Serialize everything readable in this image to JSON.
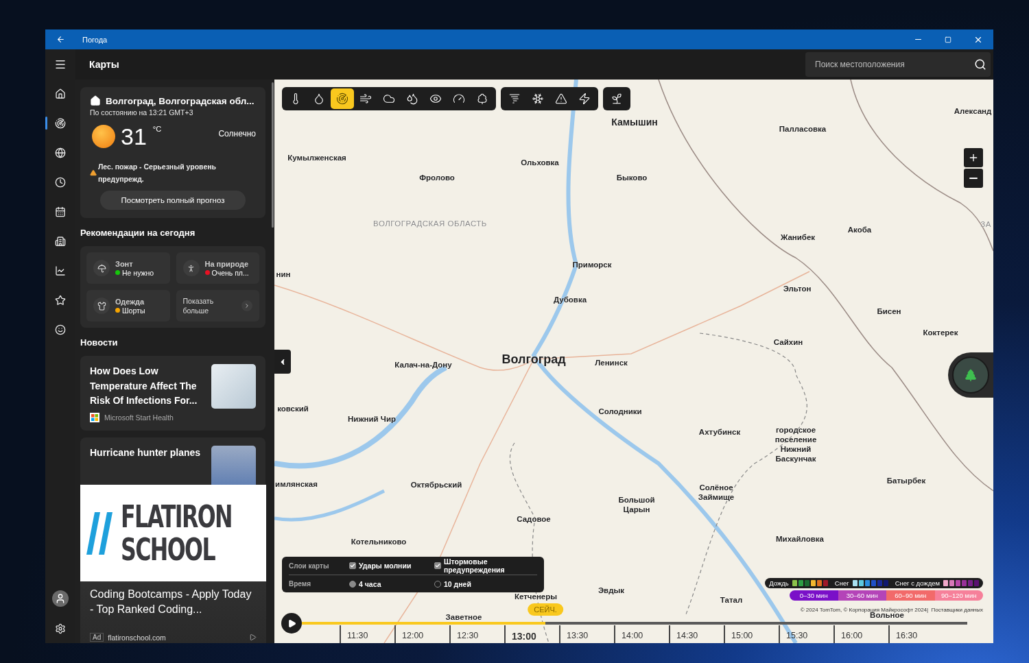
{
  "window": {
    "title": "Погода"
  },
  "nav": {
    "items": [
      {
        "selected": false
      },
      {
        "selected": true
      },
      {
        "selected": false
      },
      {
        "selected": false
      },
      {
        "selected": false
      },
      {
        "selected": false
      },
      {
        "selected": false
      },
      {
        "selected": false
      },
      {
        "selected": false
      }
    ]
  },
  "header": {
    "title": "Карты",
    "search": {
      "placeholder": "Поиск местоположения"
    }
  },
  "weather": {
    "location": "Волгоград, Волгоградская обл...",
    "updated": "По состоянию на 13:21 GMT+3",
    "temperature": "31",
    "unit": "°C",
    "condition": "Солнечно",
    "alert": "Лес. пожар - Серьезный уровень предупрежд.",
    "button": "Посмотреть полный прогноз"
  },
  "recommendations": {
    "title": "Рекомендации на сегодня",
    "tiles": [
      {
        "kind": "status",
        "title": "Зонт",
        "value": "Не нужно",
        "color": "#16c60c"
      },
      {
        "kind": "status",
        "title": "На природе",
        "value": "Очень пл...",
        "color": "#e81123"
      },
      {
        "kind": "status",
        "title": "Одежда",
        "value": "Шорты",
        "color": "#f7a500"
      },
      {
        "kind": "more",
        "title": "Показать больше"
      }
    ]
  },
  "news": {
    "title": "Новости",
    "items": [
      {
        "title": "How Does Low Temperature Affect The Risk Of Infections For...",
        "source": "Microsoft Start Health"
      },
      {
        "title": "Hurricane hunter planes"
      }
    ]
  },
  "ad": {
    "logo": [
      "FLATIRON",
      "SCHOOL"
    ],
    "title": "Coding Bootcamps - Apply Today - Top Ranked Coding...",
    "badge": "Ad",
    "domain": "flatironschool.com"
  },
  "toolbar": {
    "groups": [
      [
        {
          "selected": false
        },
        {
          "selected": false
        },
        {
          "selected": true
        },
        {
          "selected": false
        },
        {
          "selected": false
        },
        {
          "selected": false
        },
        {
          "selected": false
        },
        {
          "selected": false
        },
        {
          "selected": false
        }
      ],
      [
        {
          "selected": false
        },
        {
          "selected": false
        },
        {
          "selected": false
        },
        {
          "selected": false
        }
      ],
      [
        {
          "selected": false
        }
      ]
    ]
  },
  "map": {
    "places": [
      {
        "name": "Камышин",
        "kind": "city"
      },
      {
        "name": "Палласовка",
        "kind": "town"
      },
      {
        "name": "Александ",
        "kind": "town"
      },
      {
        "name": "Кумылженская",
        "kind": "town"
      },
      {
        "name": "Ольховка",
        "kind": "town"
      },
      {
        "name": "Фролово",
        "kind": "town"
      },
      {
        "name": "Быково",
        "kind": "town"
      },
      {
        "name": "ВОЛГОГРАДСКАЯ ОБЛАСТЬ",
        "kind": "region"
      },
      {
        "name": "ЗА",
        "kind": "region"
      },
      {
        "name": "Акоба",
        "kind": "town"
      },
      {
        "name": "Жанибек",
        "kind": "town"
      },
      {
        "name": "Приморск",
        "kind": "town"
      },
      {
        "name": "нин",
        "kind": "town"
      },
      {
        "name": "Эльтон",
        "kind": "town"
      },
      {
        "name": "Дубовка",
        "kind": "town"
      },
      {
        "name": "Бисен",
        "kind": "town"
      },
      {
        "name": "Коктерек",
        "kind": "town"
      },
      {
        "name": "Сайхин",
        "kind": "town"
      },
      {
        "name": "Калач-на-Дону",
        "kind": "town"
      },
      {
        "name": "Волгоград",
        "kind": "capital"
      },
      {
        "name": "Ленинск",
        "kind": "town"
      },
      {
        "name": "ковский",
        "kind": "town"
      },
      {
        "name": "Солодники",
        "kind": "town"
      },
      {
        "name": "Нижний Чир",
        "kind": "town"
      },
      {
        "name": "Ахтубинск",
        "kind": "town"
      },
      {
        "name": "городское поселение Нижний Баскунчак",
        "kind": "town"
      },
      {
        "name": "Батырбек",
        "kind": "town"
      },
      {
        "name": "имлянская",
        "kind": "town"
      },
      {
        "name": "Октябрьский",
        "kind": "town"
      },
      {
        "name": "Солёное Займище",
        "kind": "town"
      },
      {
        "name": "Большой Царын",
        "kind": "town"
      },
      {
        "name": "Садовое",
        "kind": "town"
      },
      {
        "name": "Михайловка",
        "kind": "town"
      },
      {
        "name": "Котельниково",
        "kind": "town"
      },
      {
        "name": "Кетченеры",
        "kind": "town"
      },
      {
        "name": "Эвдык",
        "kind": "town"
      },
      {
        "name": "Татал",
        "kind": "town"
      },
      {
        "name": "Заветное",
        "kind": "town"
      },
      {
        "name": "Вольное",
        "kind": "town"
      }
    ]
  },
  "layers": {
    "rows": [
      {
        "title": "Слои карты",
        "options": [
          {
            "kind": "checkbox",
            "label": "Удары молнии",
            "checked": true
          },
          {
            "kind": "checkbox",
            "label": "Штормовые предупреждения",
            "checked": true
          }
        ]
      },
      {
        "title": "Время",
        "options": [
          {
            "kind": "radio",
            "label": "4 часа",
            "selected": true
          },
          {
            "kind": "radio",
            "label": "10 дней",
            "selected": false
          }
        ]
      }
    ]
  },
  "timeline": {
    "now": "СЕЙЧ.",
    "level": 0.366,
    "ticks": [
      {
        "label": "11:30",
        "selected": false
      },
      {
        "label": "12:00",
        "selected": false
      },
      {
        "label": "12:30",
        "selected": false
      },
      {
        "label": "13:00",
        "selected": true
      },
      {
        "label": "13:30",
        "selected": false
      },
      {
        "label": "14:00",
        "selected": false
      },
      {
        "label": "14:30",
        "selected": false
      },
      {
        "label": "15:00",
        "selected": false
      },
      {
        "label": "15:30",
        "selected": false
      },
      {
        "label": "16:00",
        "selected": false
      },
      {
        "label": "16:30",
        "selected": false
      }
    ]
  },
  "legend": {
    "groups": [
      {
        "label": "Дождь",
        "swatches": [
          {
            "color": "#8bc34a"
          },
          {
            "color": "#2e9e44"
          },
          {
            "color": "#1b6b30"
          },
          {
            "color": "#f2b730"
          },
          {
            "color": "#e07020"
          },
          {
            "color": "#a01828"
          }
        ]
      },
      {
        "label": "Снег",
        "swatches": [
          {
            "color": "#a8e0f0"
          },
          {
            "color": "#5cc8e0"
          },
          {
            "color": "#2a8ee0"
          },
          {
            "color": "#2050c8"
          },
          {
            "color": "#1a2a9a"
          },
          {
            "color": "#101870"
          }
        ]
      },
      {
        "label": "Снег с дождем",
        "swatches": [
          {
            "color": "#f0a8c8"
          },
          {
            "color": "#d878b8"
          },
          {
            "color": "#b848a8"
          },
          {
            "color": "#983098"
          },
          {
            "color": "#782088"
          },
          {
            "color": "#5a1070"
          }
        ]
      }
    ],
    "durations": [
      {
        "label": "0–30 мин",
        "color": "#7a10c8"
      },
      {
        "label": "30–60 мин",
        "color": "#b444b8"
      },
      {
        "label": "60–90 мин",
        "color": "#f26a6a"
      },
      {
        "label": "90–120 мин",
        "color": "#f6809a"
      }
    ],
    "copyright": "© 2024 TomTom, © Корпорация Майкрософт 2024|  Поставщики данных"
  }
}
